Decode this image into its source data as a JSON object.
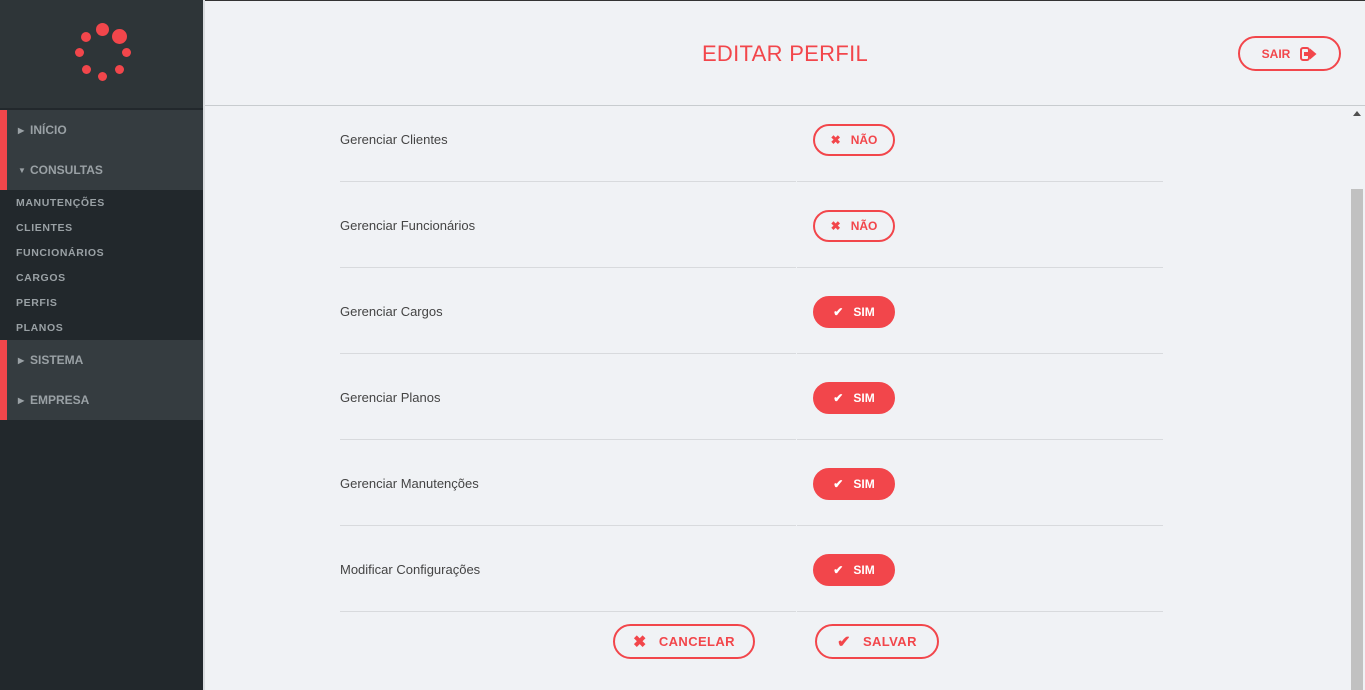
{
  "header": {
    "title": "EDITAR PERFIL",
    "logout_label": "SAIR"
  },
  "sidebar": {
    "menu": [
      {
        "label": "INÍCIO",
        "expanded": false
      },
      {
        "label": "CONSULTAS",
        "expanded": true
      },
      {
        "label": "SISTEMA",
        "expanded": false
      },
      {
        "label": "EMPRESA",
        "expanded": false
      }
    ],
    "submenu": [
      "MANUTENÇÕES",
      "CLIENTES",
      "FUNCIONÁRIOS",
      "CARGOS",
      "PERFIS",
      "PLANOS"
    ]
  },
  "permissions": [
    {
      "label": "Gerenciar Clientes",
      "value": "NÃO"
    },
    {
      "label": "Gerenciar Funcionários",
      "value": "NÃO"
    },
    {
      "label": "Gerenciar Cargos",
      "value": "SIM"
    },
    {
      "label": "Gerenciar Planos",
      "value": "SIM"
    },
    {
      "label": "Gerenciar Manutenções",
      "value": "SIM"
    },
    {
      "label": "Modificar Configurações",
      "value": "SIM"
    }
  ],
  "actions": {
    "cancel_label": "CANCELAR",
    "save_label": "SALVAR"
  },
  "colors": {
    "accent": "#f2464b",
    "sidebar_bg": "#22282c",
    "menu_bg": "#353c40",
    "page_bg": "#f0f2f5"
  },
  "icons": {
    "logout": "sign-out-icon",
    "yes": "check-icon",
    "no": "times-icon",
    "caret_closed": "caret-right-icon",
    "caret_open": "caret-down-icon"
  }
}
